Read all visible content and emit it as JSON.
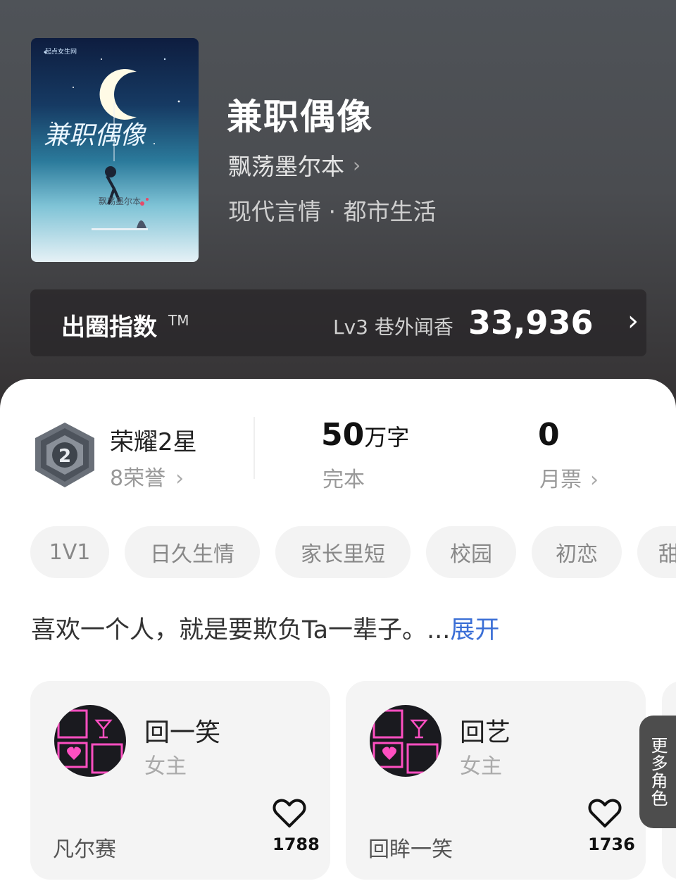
{
  "book": {
    "cover_title": "兼职偶像",
    "title": "兼职偶像",
    "author": "飘荡墨尔本",
    "author_chevron": "›",
    "genre": "现代言情 · 都市生活"
  },
  "circle_index": {
    "label": "出圈指数",
    "tm": "TM",
    "level": "Lv3 巷外闻香",
    "score": "33,936",
    "arrow": "›"
  },
  "stats": {
    "honor_title": "荣耀2星",
    "honor_sub": "8荣誉",
    "honor_badge_number": "2",
    "words_num": "50",
    "words_unit": "万字",
    "words_label": "完本",
    "tickets_num": "0",
    "tickets_label": "月票",
    "chevron": "›"
  },
  "tags": [
    "1V1",
    "日久生情",
    "家长里短",
    "校园",
    "初恋",
    "甜"
  ],
  "intro": {
    "text": "喜欢一个人，就是要欺负Ta一辈子。...",
    "more": "展开"
  },
  "roles": [
    {
      "name": "回一笑",
      "type": "女主",
      "desc": "凡尔赛",
      "likes": "1788"
    },
    {
      "name": "回艺",
      "type": "女主",
      "desc": "回眸一笑",
      "likes": "1736"
    }
  ],
  "more_roles_label": "更多角色",
  "colors": {
    "accent_link": "#3b6fd6",
    "header_bg": "#4a4c50",
    "avatar_neon": "#ff4fc1"
  },
  "icons": {
    "chevron": "chevron-right-icon",
    "heart": "heart-outline-icon",
    "badge": "honor-star-badge-icon"
  }
}
